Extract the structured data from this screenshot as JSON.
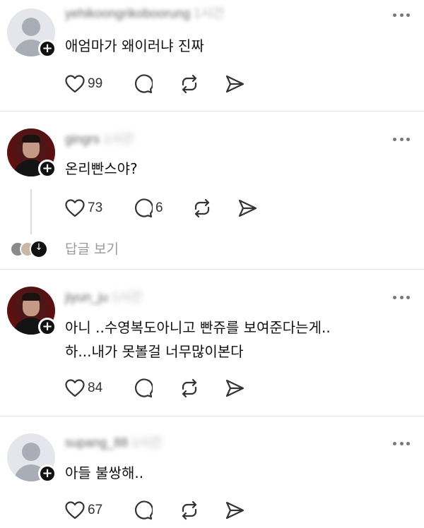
{
  "posts": [
    {
      "username": "yehikoongrikoboorung",
      "time": "1시간",
      "text_lines": [
        "애엄마가 왜이러냐 진짜"
      ],
      "likes": "99",
      "comments": "",
      "avatar": "default"
    },
    {
      "username": "gingrs",
      "time": "1시간",
      "text_lines": [
        "온리빤스야?"
      ],
      "likes": "73",
      "comments": "6",
      "avatar": "photo"
    },
    {
      "username": "jiyun_ju",
      "time": "1시간",
      "text_lines": [
        "아니 ..수영복도아니고 빤쥬를 보여준다는게..",
        "하...내가 못볼걸 너무많이본다"
      ],
      "likes": "84",
      "comments": "",
      "avatar": "photo"
    },
    {
      "username": "supang_88",
      "time": "1시간",
      "text_lines": [
        "아들 불쌍해.."
      ],
      "likes": "67",
      "comments": "",
      "avatar": "default"
    }
  ],
  "replies_label": "답글 보기",
  "icons": {
    "like": "heart-icon",
    "comment": "comment-bubble-icon",
    "repost": "repost-icon",
    "share": "send-icon",
    "more": "more-dots-icon",
    "follow": "plus-icon"
  }
}
